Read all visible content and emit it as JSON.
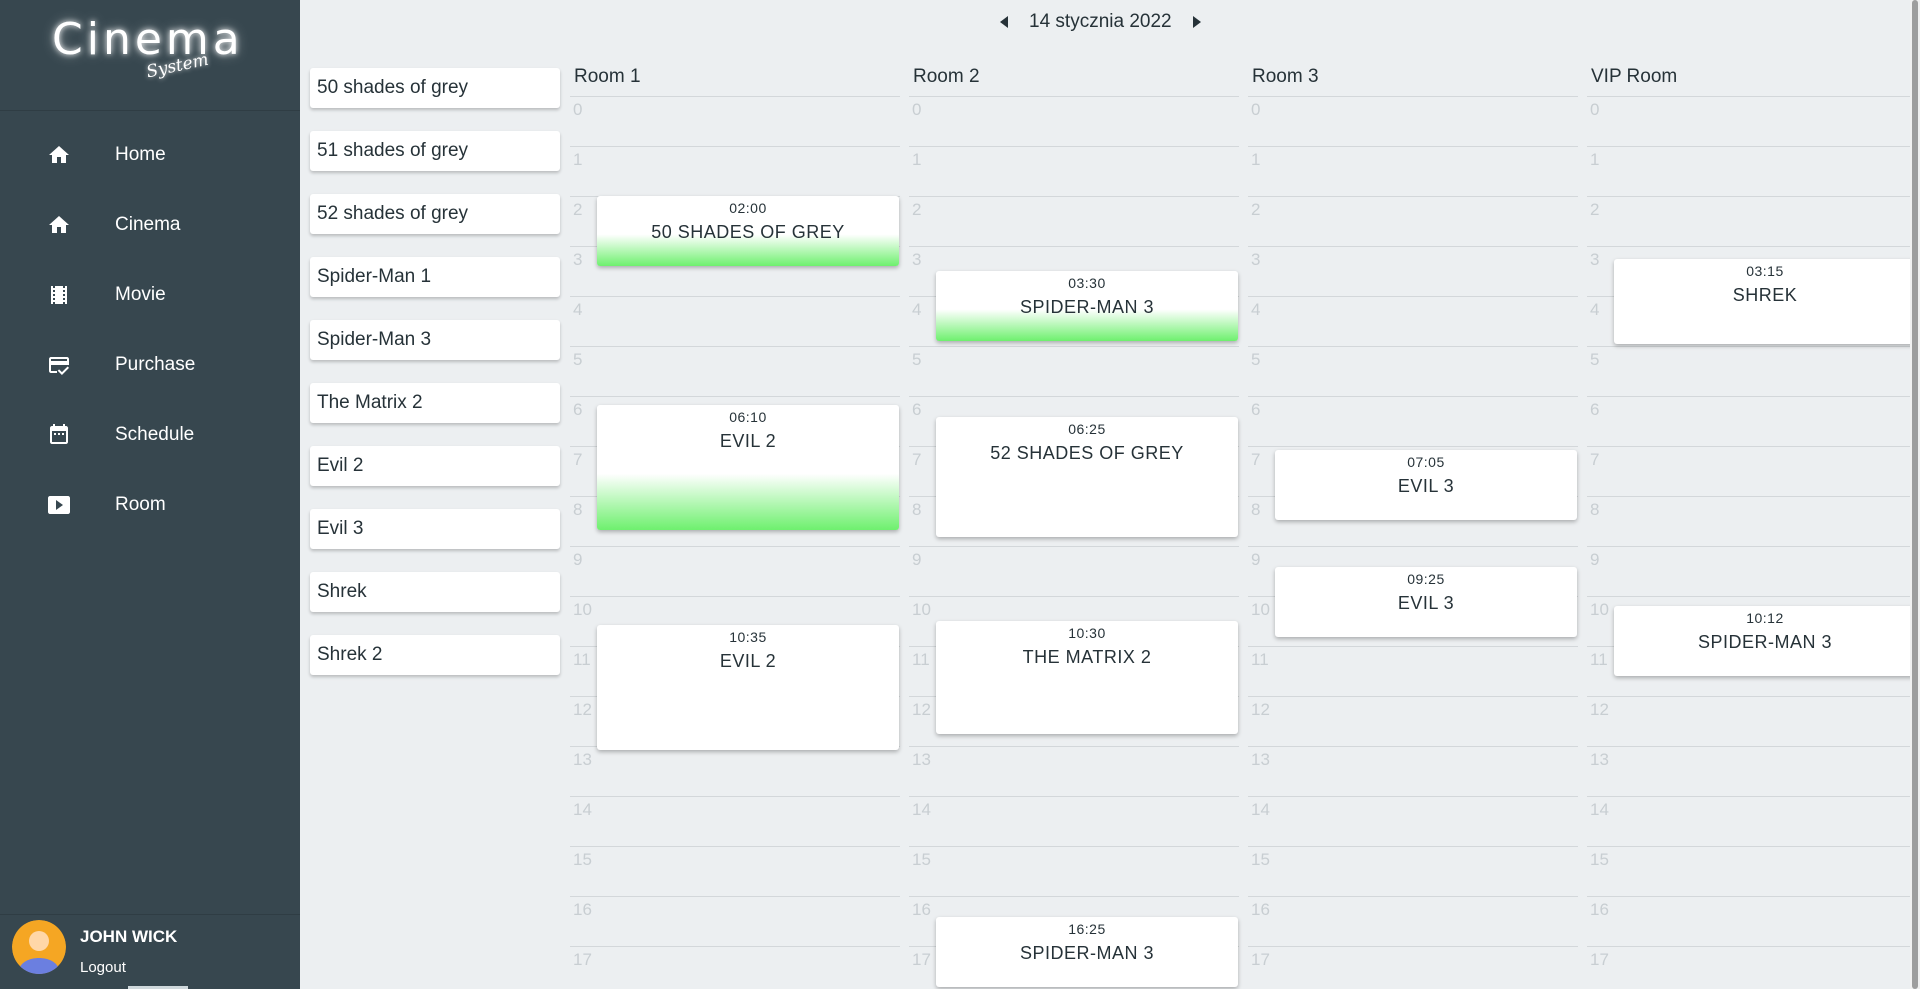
{
  "logo": {
    "main": "Cinema",
    "sub": "System"
  },
  "nav": [
    {
      "label": "Home",
      "icon": "home-icon"
    },
    {
      "label": "Cinema",
      "icon": "home-icon"
    },
    {
      "label": "Movie",
      "icon": "film-icon"
    },
    {
      "label": "Purchase",
      "icon": "credit-card-icon"
    },
    {
      "label": "Schedule",
      "icon": "calendar-icon"
    },
    {
      "label": "Room",
      "icon": "play-icon"
    }
  ],
  "user": {
    "name": "JOHN WICK",
    "logout": "Logout"
  },
  "date": {
    "label": "14 stycznia 2022"
  },
  "movies": [
    "50 shades of grey",
    "51 shades of grey",
    "52 shades of grey",
    "Spider-Man 1",
    "Spider-Man 3",
    "The Matrix 2",
    "Evil 2",
    "Evil 3",
    "Shrek",
    "Shrek 2"
  ],
  "hours": [
    "0",
    "1",
    "2",
    "3",
    "4",
    "5",
    "6",
    "7",
    "8",
    "9",
    "10",
    "11",
    "12",
    "13",
    "14",
    "15",
    "16",
    "17"
  ],
  "rooms": [
    {
      "name": "Room 1",
      "shows": [
        {
          "time": "02:00",
          "title": "50 SHADES OF GREY",
          "start": 2.0,
          "duration": 1.4,
          "highlight": true
        },
        {
          "time": "06:10",
          "title": "EVIL 2",
          "start": 6.17,
          "duration": 2.5,
          "highlight": true
        },
        {
          "time": "10:35",
          "title": "EVIL 2",
          "start": 10.58,
          "duration": 2.5,
          "highlight": false
        }
      ]
    },
    {
      "name": "Room 2",
      "shows": [
        {
          "time": "03:30",
          "title": "SPIDER-MAN 3",
          "start": 3.5,
          "duration": 1.4,
          "highlight": true
        },
        {
          "time": "06:25",
          "title": "52 SHADES OF GREY",
          "start": 6.42,
          "duration": 2.4,
          "highlight": false
        },
        {
          "time": "10:30",
          "title": "THE MATRIX 2",
          "start": 10.5,
          "duration": 2.25,
          "highlight": false
        },
        {
          "time": "16:25",
          "title": "SPIDER-MAN 3",
          "start": 16.42,
          "duration": 1.4,
          "highlight": false
        }
      ]
    },
    {
      "name": "Room 3",
      "shows": [
        {
          "time": "07:05",
          "title": "EVIL 3",
          "start": 7.08,
          "duration": 1.4,
          "highlight": false
        },
        {
          "time": "09:25",
          "title": "EVIL 3",
          "start": 9.42,
          "duration": 1.4,
          "highlight": false
        }
      ]
    },
    {
      "name": "VIP Room",
      "shows": [
        {
          "time": "03:15",
          "title": "SHREK",
          "start": 3.25,
          "duration": 1.7,
          "highlight": false
        },
        {
          "time": "10:12",
          "title": "SPIDER-MAN 3",
          "start": 10.2,
          "duration": 1.4,
          "highlight": false
        }
      ]
    }
  ]
}
